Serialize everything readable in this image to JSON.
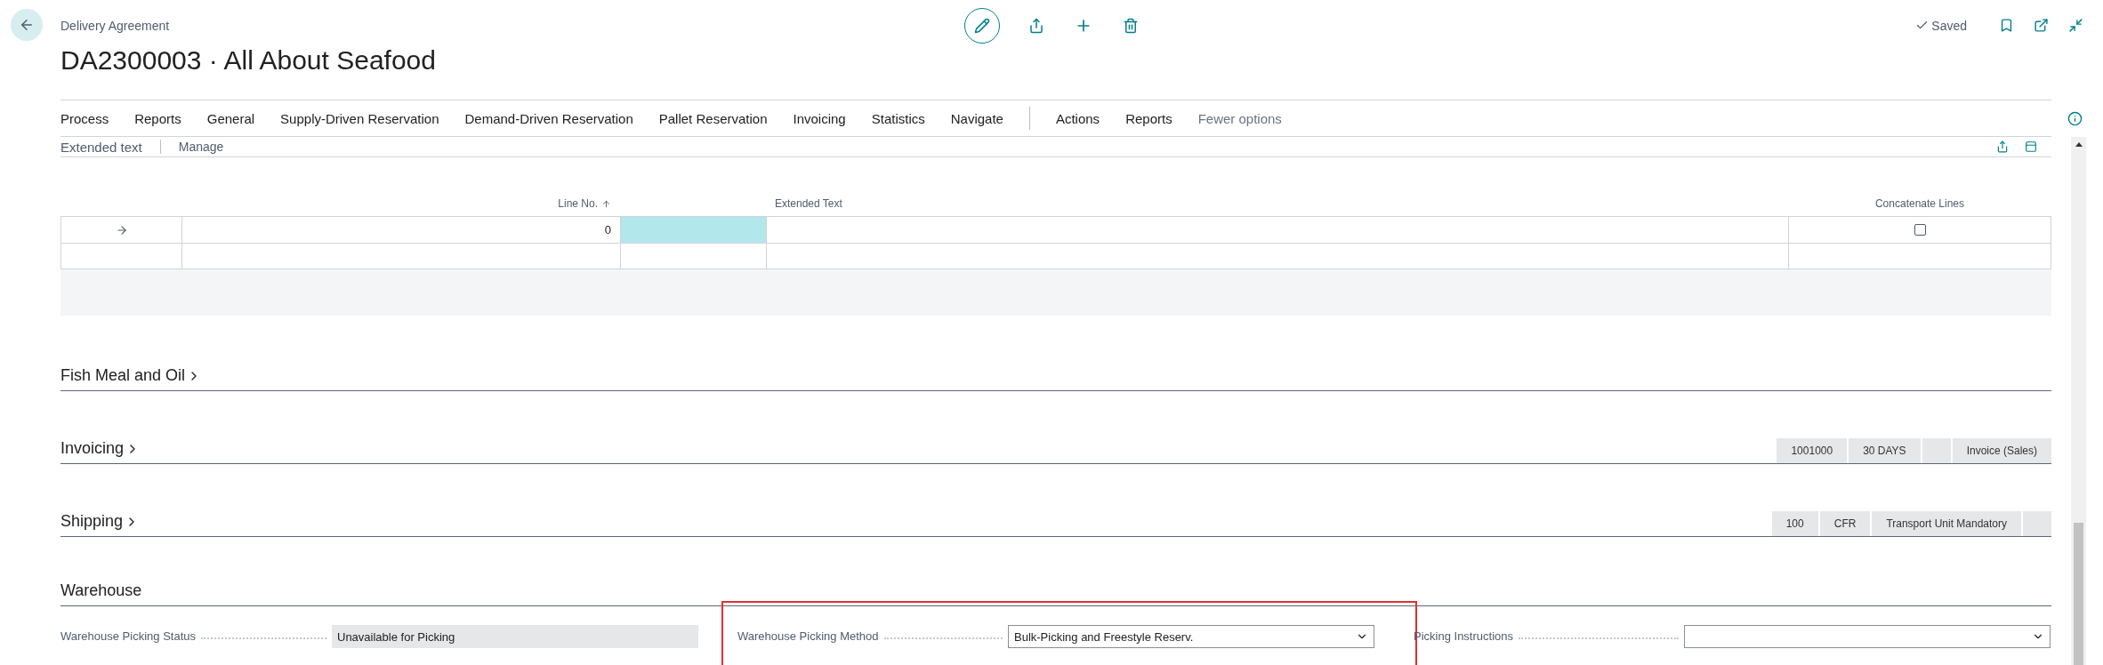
{
  "header": {
    "breadcrumb": "Delivery Agreement",
    "title": "DA2300003 · All About Seafood",
    "status": "Saved"
  },
  "menu": {
    "primary": [
      "Process",
      "Reports",
      "General",
      "Supply-Driven Reservation",
      "Demand-Driven Reservation",
      "Pallet Reservation",
      "Invoicing",
      "Statistics",
      "Navigate"
    ],
    "secondary": [
      "Actions",
      "Reports"
    ],
    "toggle": "Fewer options"
  },
  "extended_text": {
    "title": "Extended text",
    "action": "Manage",
    "columns": {
      "line_no": "Line No.",
      "text": "Extended Text",
      "concatenate": "Concatenate Lines"
    },
    "rows": [
      {
        "kind": "line",
        "current": true,
        "line_no": "0",
        "concatenate": false
      },
      {
        "kind": "blank",
        "current": false
      }
    ]
  },
  "sections": [
    {
      "title": "Fish Meal and Oil"
    },
    {
      "title": "Invoicing",
      "chips": [
        {
          "kind": "value",
          "text": "1001000"
        },
        {
          "kind": "value",
          "text": "30 DAYS"
        },
        {
          "kind": "empty"
        },
        {
          "kind": "value",
          "text": "Invoice (Sales)"
        }
      ]
    },
    {
      "title": "Shipping",
      "chips": [
        {
          "kind": "value",
          "text": "100"
        },
        {
          "kind": "value",
          "text": "CFR"
        },
        {
          "kind": "value",
          "text": "Transport Unit Mandatory"
        },
        {
          "kind": "empty"
        }
      ]
    }
  ],
  "warehouse": {
    "title": "Warehouse",
    "fields": [
      {
        "kind": "readonly",
        "label": "Warehouse Picking Status",
        "value": "Unavailable for Picking",
        "highlighted": false
      },
      {
        "kind": "select",
        "label": "Warehouse Picking Method",
        "value": "Bulk-Picking and Freestyle Reserv.",
        "highlighted": true
      },
      {
        "kind": "select",
        "label": "Picking Instructions",
        "highlighted": false
      }
    ]
  }
}
